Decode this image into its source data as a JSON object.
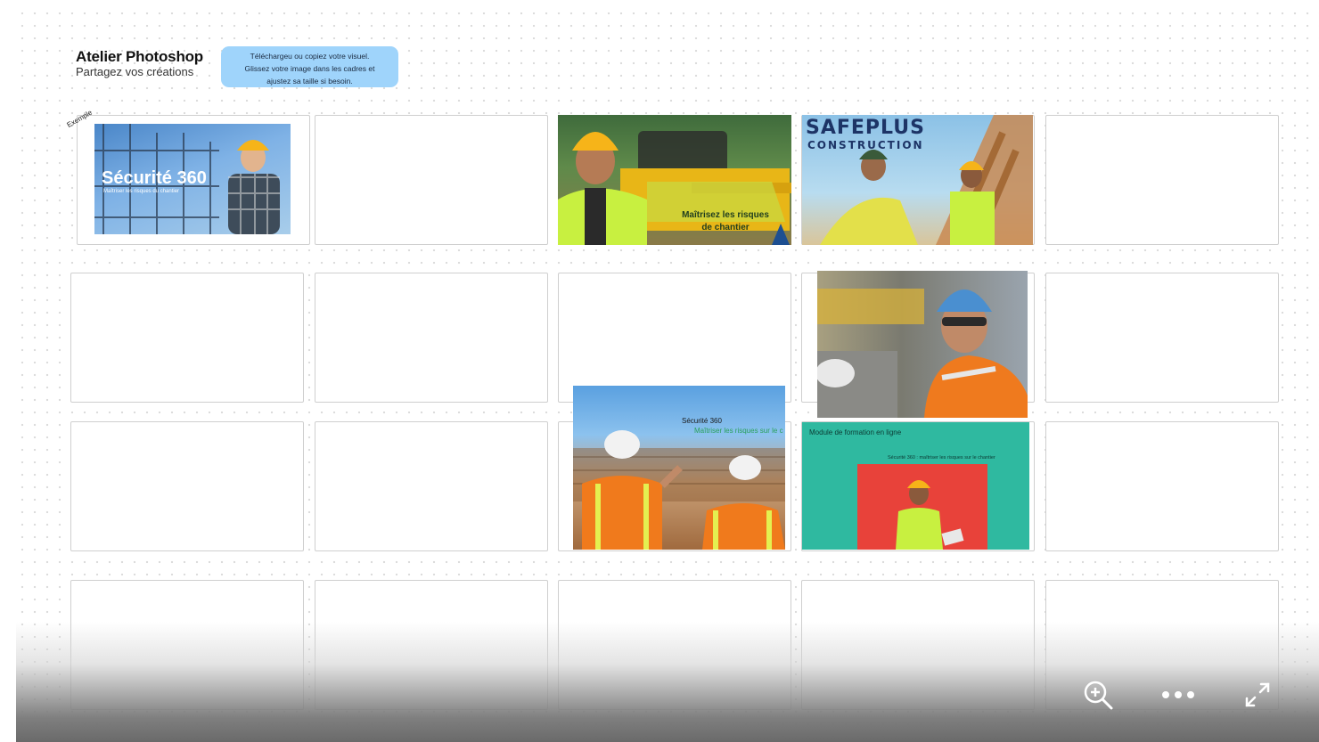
{
  "header": {
    "title": "Atelier Photoshop",
    "subtitle": "Partagez vos créations"
  },
  "sticky_note": {
    "line1": "Téléchargeu ou copiez votre visuel.",
    "line2": "Glissez votre image dans les cadres et",
    "line3": "ajustez sa taille si besoin."
  },
  "example_label": "Exemple",
  "images": {
    "securite": {
      "title": "Sécurité 360",
      "tagline": "Maîtriser les risques du chantier"
    },
    "risques": {
      "line1": "Maîtrisez les risques",
      "line2": "de chantier"
    },
    "safeplus": {
      "brand": "SAFEPLUS",
      "sub": "CONSTRUCTION"
    },
    "workers": {
      "title": "Sécurité 360",
      "tagline": "Maîtriser les risques sur le c"
    },
    "module": {
      "title": "Module de formation en ligne",
      "tagline": "Sécurité 360 : maîtriser les risques sur le chantier"
    }
  },
  "colors": {
    "sticky": "#9fd4fb",
    "frame_border": "#cfcfcf",
    "teal": "#2fb9a0",
    "red": "#e8423a",
    "vest": "#c8f040",
    "hardhat": "#f6b419"
  },
  "toolbar": {
    "zoom_icon": "zoom-in-icon",
    "more_icon": "more-dots-icon",
    "fullscreen_icon": "expand-icon"
  }
}
